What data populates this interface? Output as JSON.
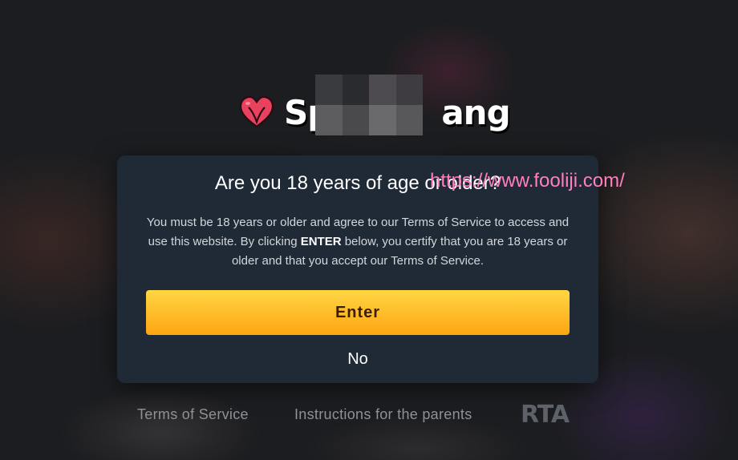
{
  "brand": {
    "name_visible": "Sp      ang",
    "name_prefix": "Sp",
    "name_suffix": "ang"
  },
  "modal": {
    "title": "Are you 18 years of age or older?",
    "body_part1": "You must be 18 years or older and agree to our Terms of Service to access and use this website. By clicking ",
    "body_bold": "ENTER",
    "body_part2": " below, you certify that you are 18 years or older and that you accept our Terms of Service.",
    "enter_label": "Enter",
    "no_label": "No"
  },
  "watermark": "https://www.fooliji.com/",
  "footer": {
    "terms_label": "Terms of Service",
    "parents_label": "Instructions for the parents",
    "rta_label": "RTA"
  },
  "colors": {
    "modal_bg": "#1f2a36",
    "enter_gradient_top": "#ffd643",
    "enter_gradient_bottom": "#fda512",
    "watermark": "#ff7fbf",
    "logo_heart": "#e8425e"
  }
}
